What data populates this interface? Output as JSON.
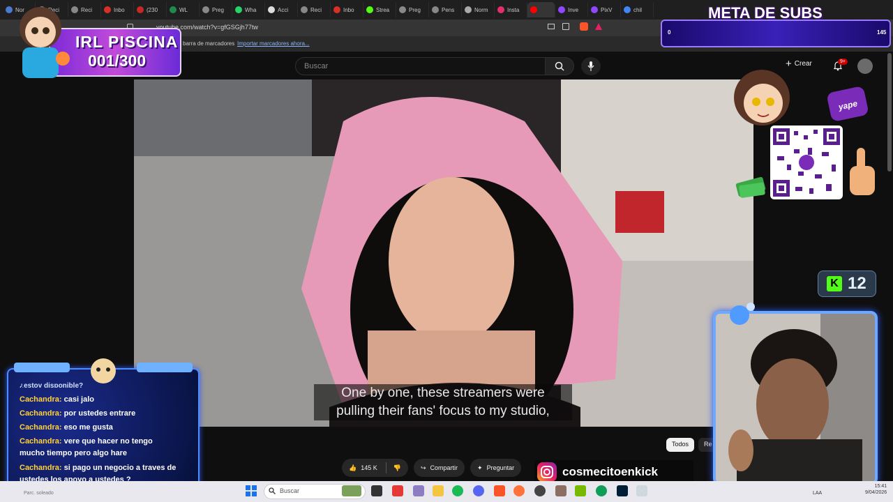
{
  "tabs": [
    {
      "label": "Nor",
      "color": "#4a7bd0"
    },
    {
      "label": "Reci",
      "color": "#888888"
    },
    {
      "label": "Reci",
      "color": "#888888"
    },
    {
      "label": "Inbo",
      "color": "#d93025"
    },
    {
      "label": "(230",
      "color": "#c62828"
    },
    {
      "label": "WL",
      "color": "#1f8b4c"
    },
    {
      "label": "Preg",
      "color": "#888888"
    },
    {
      "label": "Wha",
      "color": "#25d366"
    },
    {
      "label": "Acci",
      "color": "#dddddd"
    },
    {
      "label": "Reci",
      "color": "#888888"
    },
    {
      "label": "Inbo",
      "color": "#d93025"
    },
    {
      "label": "Strea",
      "color": "#53fc18"
    },
    {
      "label": "Preg",
      "color": "#888888"
    },
    {
      "label": "Pens",
      "color": "#888888"
    },
    {
      "label": "Norm",
      "color": "#aaaaaa"
    },
    {
      "label": "Insta",
      "color": "#e1306c"
    },
    {
      "label": "",
      "color": "#ff0000"
    },
    {
      "label": "Inve",
      "color": "#9146ff"
    },
    {
      "label": "PixV",
      "color": "#9146ff"
    },
    {
      "label": "chil",
      "color": "#4285f4"
    }
  ],
  "browser": {
    "url": "youtube.com/watch?v=gfGSGjh77tw",
    "bookmark_hint": "barra de marcadores",
    "bookmark_import": "Importar marcadores ahora..."
  },
  "youtube": {
    "search_placeholder": "Buscar",
    "create_label": "Crear",
    "notif_count": "9+",
    "caption_line1": "One by one, these streamers were",
    "caption_line2": "pulling their fans' focus to my studio,",
    "like_count": "145 K",
    "share_label": "Compartir",
    "ask_label": "Preguntar",
    "chip_all": "Todos",
    "chip_next": "Re"
  },
  "overlay": {
    "irl_title": "IRL PISCINA",
    "irl_count": "001/300",
    "meta_title": "META DE SUBS",
    "meta_start": "0",
    "meta_value": "145",
    "yape_logo": "yape",
    "kick_count": "12",
    "brand_handle": "cosmecitoenkick"
  },
  "chat": {
    "partial_line": "¿estoy disponible?",
    "messages": [
      {
        "user": "Cachandra:",
        "text": " casi jalo"
      },
      {
        "user": "Cachandra:",
        "text": " por ustedes entrare"
      },
      {
        "user": "Cachandra:",
        "text": " eso me gusta"
      },
      {
        "user": "Cachandra:",
        "text": " vere que hacer no tengo mucho tiempo pero algo hare"
      },
      {
        "user": "Cachandra:",
        "text": " si pago un negocio a traves de ustedes los apoyo a ustedes ?"
      }
    ]
  },
  "taskbar": {
    "search_placeholder": "Buscar",
    "lang": "LAA",
    "time": "15:41",
    "date": "9/04/2026",
    "status_left": "Parc. soleado"
  }
}
